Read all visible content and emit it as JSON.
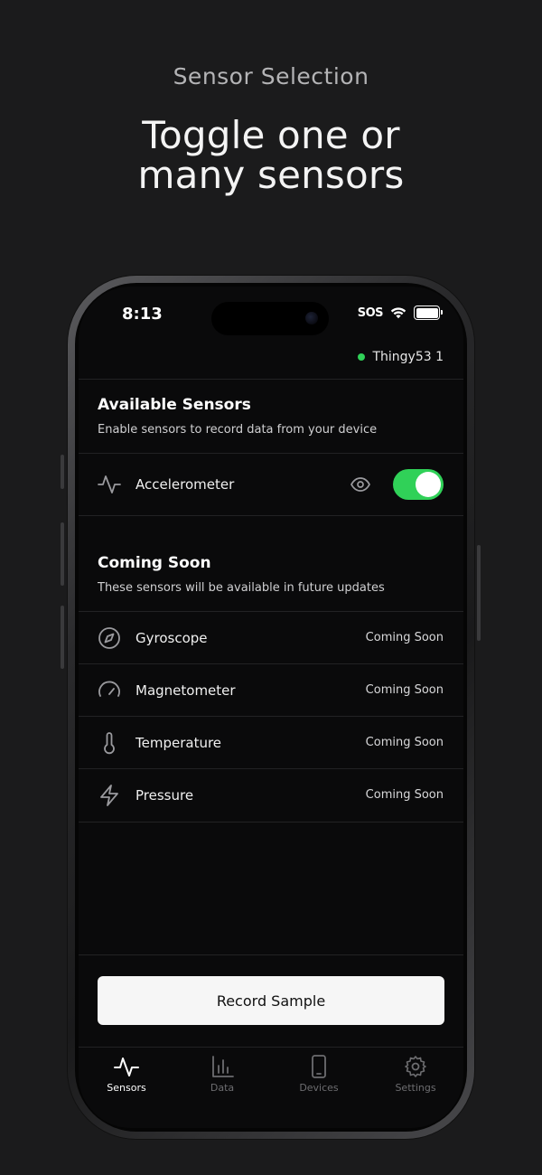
{
  "promo": {
    "eyebrow": "Sensor Selection",
    "headline_line1": "Toggle one or",
    "headline_line2": "many sensors"
  },
  "status_bar": {
    "time": "8:13",
    "carrier": "SOS",
    "icons": [
      "wifi-icon",
      "battery-icon"
    ]
  },
  "device": {
    "name": "Thingy53 1",
    "status_color": "#30d158"
  },
  "available": {
    "title": "Available Sensors",
    "subtitle": "Enable sensors to record data from your device",
    "sensors": [
      {
        "label": "Accelerometer",
        "icon": "activity-icon",
        "enabled": true,
        "preview_icon": "eye-icon"
      }
    ]
  },
  "coming_soon": {
    "title": "Coming Soon",
    "subtitle": "These sensors will be available in future updates",
    "sensors": [
      {
        "label": "Gyroscope",
        "icon": "compass-icon",
        "tag": "Coming Soon"
      },
      {
        "label": "Magnetometer",
        "icon": "gauge-icon",
        "tag": "Coming Soon"
      },
      {
        "label": "Temperature",
        "icon": "thermometer-icon",
        "tag": "Coming Soon"
      },
      {
        "label": "Pressure",
        "icon": "lightning-icon",
        "tag": "Coming Soon"
      }
    ]
  },
  "actions": {
    "record_label": "Record Sample"
  },
  "tabs": [
    {
      "label": "Sensors",
      "icon": "activity-icon",
      "active": true
    },
    {
      "label": "Data",
      "icon": "bar-chart-icon",
      "active": false
    },
    {
      "label": "Devices",
      "icon": "phone-icon",
      "active": false
    },
    {
      "label": "Settings",
      "icon": "gear-icon",
      "active": false
    }
  ],
  "colors": {
    "accent_green": "#30d158",
    "background": "#1b1b1c",
    "screen": "#0a0a0b"
  }
}
